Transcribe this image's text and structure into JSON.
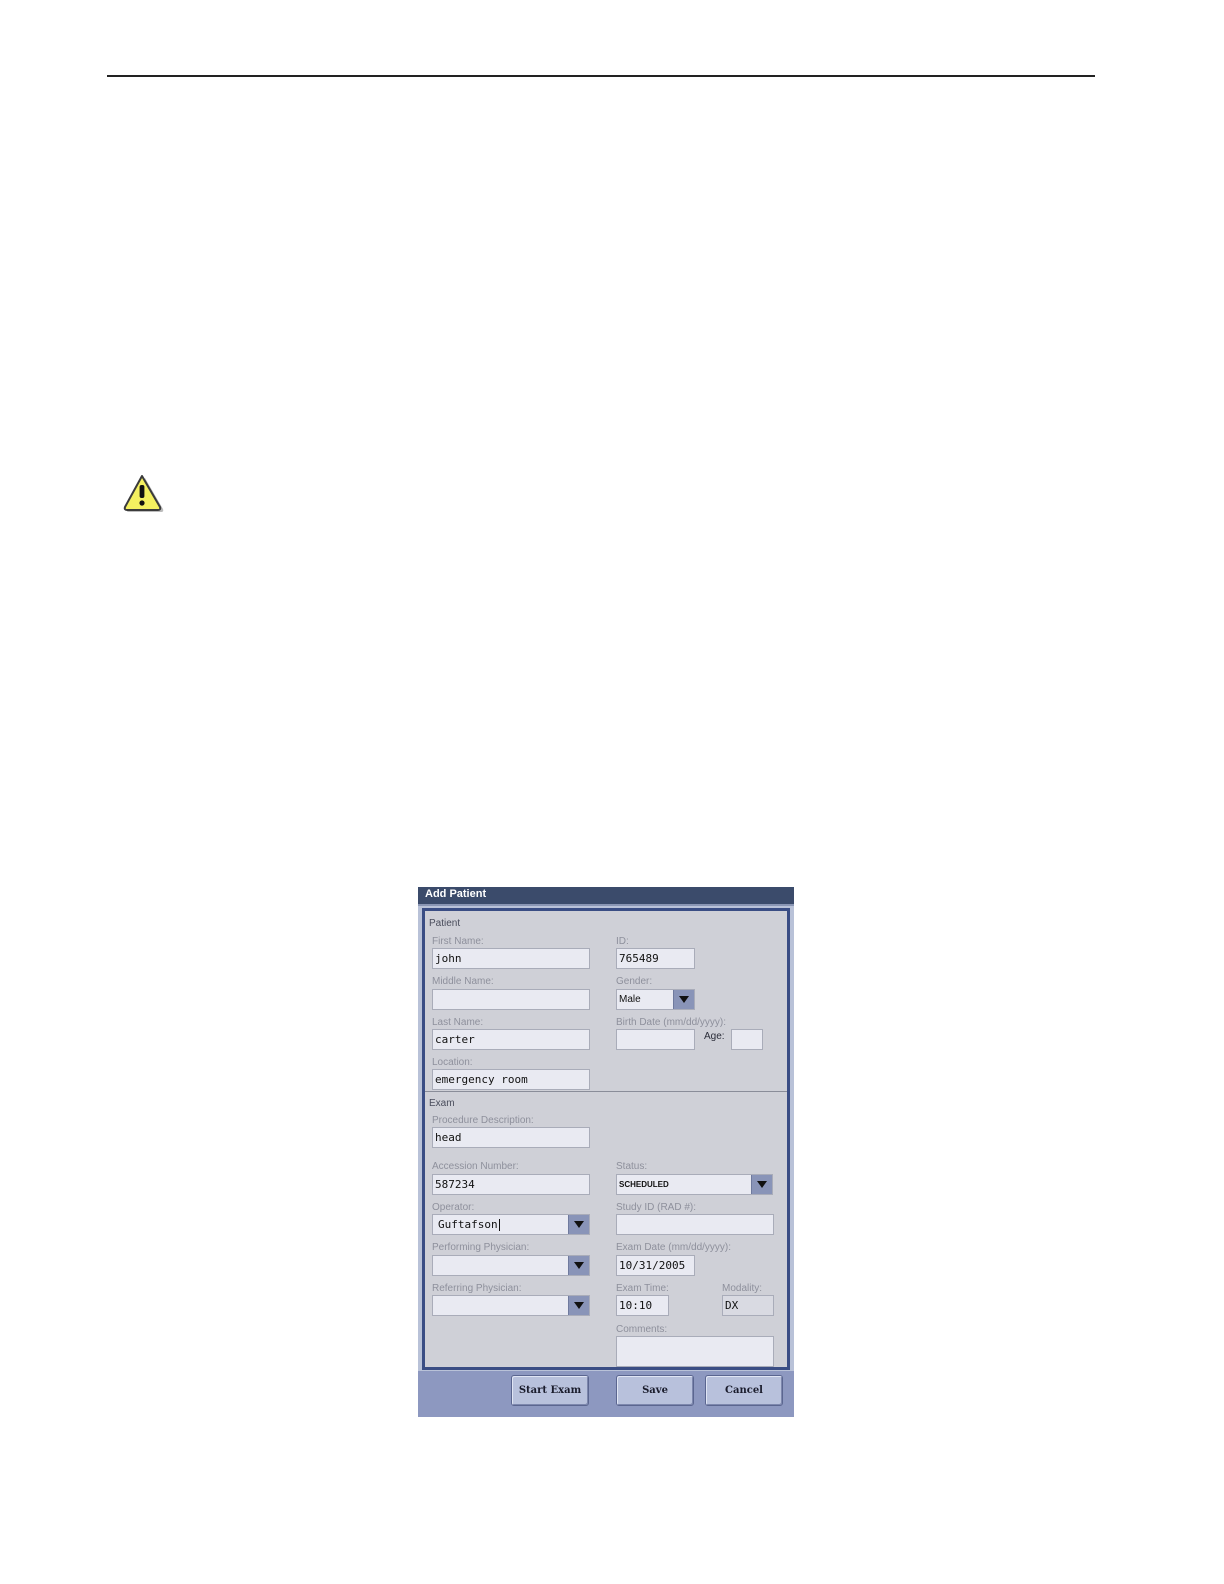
{
  "dialog": {
    "title": "Add Patient",
    "patient": {
      "section_label": "Patient",
      "first_name": {
        "label": "First Name:",
        "value": "john"
      },
      "middle_name": {
        "label": "Middle Name:",
        "value": ""
      },
      "last_name": {
        "label": "Last Name:",
        "value": "carter"
      },
      "location": {
        "label": "Location:",
        "value": "emergency room"
      },
      "id": {
        "label": "ID:",
        "value": "765489"
      },
      "gender": {
        "label": "Gender:",
        "value": "Male"
      },
      "birth_date": {
        "label": "Birth Date (mm/dd/yyyy):",
        "value": ""
      },
      "age": {
        "label": "Age:",
        "value": ""
      }
    },
    "exam": {
      "section_label": "Exam",
      "procedure_description": {
        "label": "Procedure Description:",
        "value": "head"
      },
      "accession_number": {
        "label": "Accession Number:",
        "value": "587234"
      },
      "operator": {
        "label": "Operator:",
        "value": "Guftafson"
      },
      "performing_physician": {
        "label": "Performing Physician:",
        "value": ""
      },
      "referring_physician": {
        "label": "Referring Physician:",
        "value": ""
      },
      "status": {
        "label": "Status:",
        "value": "SCHEDULED"
      },
      "study_id": {
        "label": "Study ID (RAD #):",
        "value": ""
      },
      "exam_date": {
        "label": "Exam Date (mm/dd/yyyy):",
        "value": "10/31/2005"
      },
      "exam_time": {
        "label": "Exam Time:",
        "value": "10:10"
      },
      "modality": {
        "label": "Modality:",
        "value": "DX"
      },
      "comments": {
        "label": "Comments:",
        "value": ""
      }
    },
    "buttons": {
      "start_exam": "Start Exam",
      "save": "Save",
      "cancel": "Cancel"
    }
  },
  "icons": {
    "warning": "warning-icon"
  },
  "colors": {
    "title_bar": "#3b4b6b",
    "panel_border": "#3a4d84",
    "footer": "#8d98c0",
    "warning_fill": "#f4f060"
  }
}
